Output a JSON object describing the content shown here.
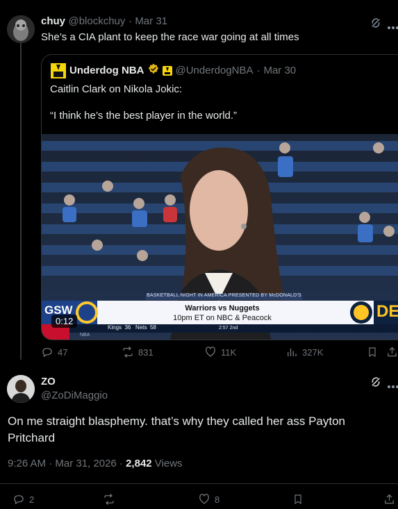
{
  "first_post": {
    "display_name": "chuy",
    "handle": "@blockchuy",
    "sep": "·",
    "date": "Mar 31",
    "text": "She’s a CIA plant to keep the race war going at all times",
    "quote": {
      "display_name": "Underdog NBA",
      "handle": "@UnderdogNBA",
      "sep": "·",
      "date": "Mar 30",
      "line1": "Caitlin Clark on Nikola Jokic:",
      "line2": "“I think he’s the best player in the world.”",
      "video": {
        "duration": "0:12",
        "banner": "BASKETBALL NIGHT IN AMERICA PRESENTED BY McDONALD'S",
        "matchup": "Warriors vs Nuggets",
        "time_line": "10pm ET on NBC & Peacock",
        "right_badge": "DE",
        "ticker_a": "Kings",
        "ticker_a_score": "36",
        "ticker_b": "Nets",
        "ticker_b_score": "58",
        "ticker_clock": "2:57  2nd",
        "left_badge": "GSW",
        "nba_small": "NBA"
      }
    },
    "actions": {
      "replies": "47",
      "reposts": "831",
      "likes": "11K",
      "views": "327K"
    }
  },
  "second_post": {
    "display_name": "ZO",
    "handle": "@ZoDiMaggio",
    "text": "On me straight blasphemy. that’s why they called her ass Payton Pritchard",
    "time": "9:26 AM · Mar 31, 2026 · ",
    "views_count": "2,842",
    "views_label": " Views",
    "actions": {
      "replies": "2",
      "likes": "8"
    }
  },
  "colors": {
    "background": "#000000",
    "text": "#e7e9ea",
    "muted": "#71767b",
    "border": "#2f3336",
    "verified_gold": "#e2b719"
  }
}
